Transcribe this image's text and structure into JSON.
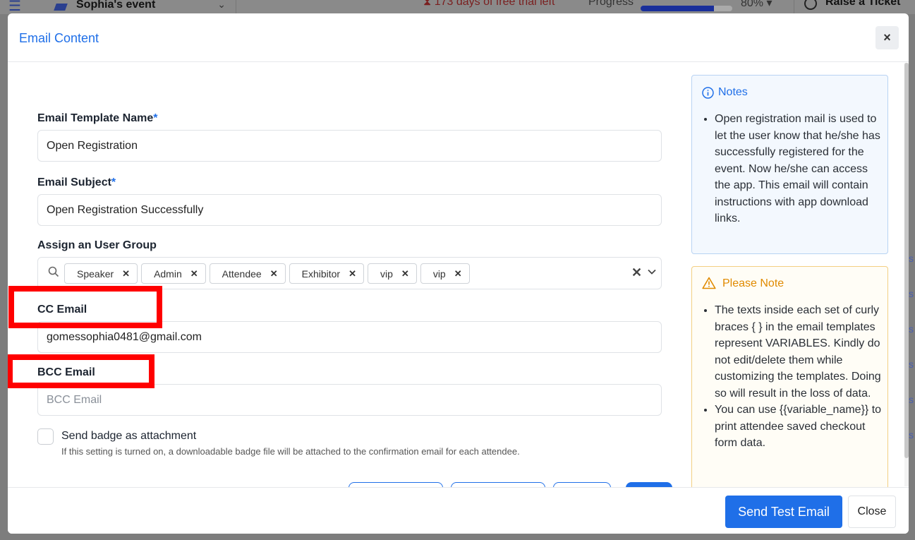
{
  "background": {
    "event_name": "Sophia's event",
    "trial_text": "173 days of free trial left",
    "progress_label": "Progress",
    "progress_value": "80%",
    "progress_fraction": 0.8,
    "raise_ticket": "Raise a Ticket"
  },
  "modal": {
    "title": "Email Content",
    "close_symbol": "×"
  },
  "form": {
    "template_name_label": "Email Template Name",
    "template_name_value": "Open Registration",
    "subject_label": "Email Subject",
    "subject_value": "Open Registration Successfully",
    "required_mark": "*",
    "user_group_label": "Assign an User Group",
    "user_groups": [
      "Speaker",
      "Admin",
      "Attendee",
      "Exhibitor",
      "vip",
      "vip"
    ],
    "cc_label": "CC Email",
    "cc_value": "gomessophia0481@gmail.com",
    "bcc_label": "BCC Email",
    "bcc_placeholder": "BCC Email",
    "badge_label": "Send badge as attachment",
    "badge_help": "If this setting is turned on, a downloadable badge file will be attached to the confirmation email for each attendee."
  },
  "notes": {
    "title": "Notes",
    "items": [
      "Open registration mail is used to let the user know that he/she has successfully registered for the event. Now he/she can access the app. This email will contain instructions with app download links."
    ]
  },
  "please_note": {
    "title": "Please Note",
    "items": [
      "The texts inside each set of curly braces { } in the email templates represent VARIABLES. Kindly do not edit/delete them while customizing the templates. Doing so will result in the loss of data.",
      "You can use {{variable_name}} to print attendee saved checkout form data."
    ]
  },
  "footer": {
    "send_test": "Send Test Email",
    "close": "Close"
  },
  "colors": {
    "accent": "#1f6fe8",
    "highlight": "#ff0000",
    "warning": "#e08a00"
  }
}
